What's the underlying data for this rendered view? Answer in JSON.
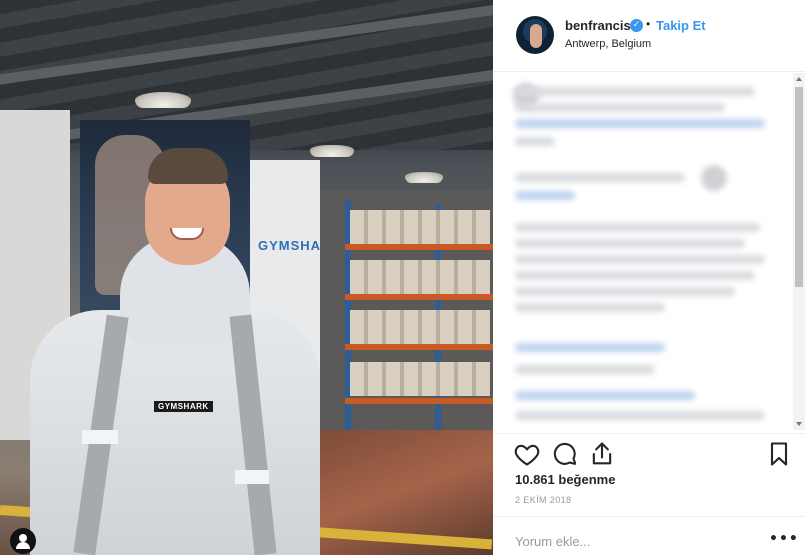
{
  "post": {
    "shirt_logo": "GYMSHARK",
    "wall_sign": "GYMSHARK"
  },
  "header": {
    "username": "benfrancis",
    "verified_icon": "verified-check-icon",
    "follow_label": "Takip Et",
    "location": "Antwerp, Belgium"
  },
  "actions": {
    "like_icon": "heart-icon",
    "comment_icon": "comment-bubble-icon",
    "share_icon": "share-icon",
    "save_icon": "bookmark-icon"
  },
  "stats": {
    "likes": "10.861 beğenme",
    "date": "2 EKİM 2018"
  },
  "comment": {
    "placeholder": "Yorum ekle...",
    "more_icon": "more-options-icon"
  },
  "colors": {
    "accent": "#3897f0",
    "text": "#262626",
    "muted": "#999999"
  }
}
